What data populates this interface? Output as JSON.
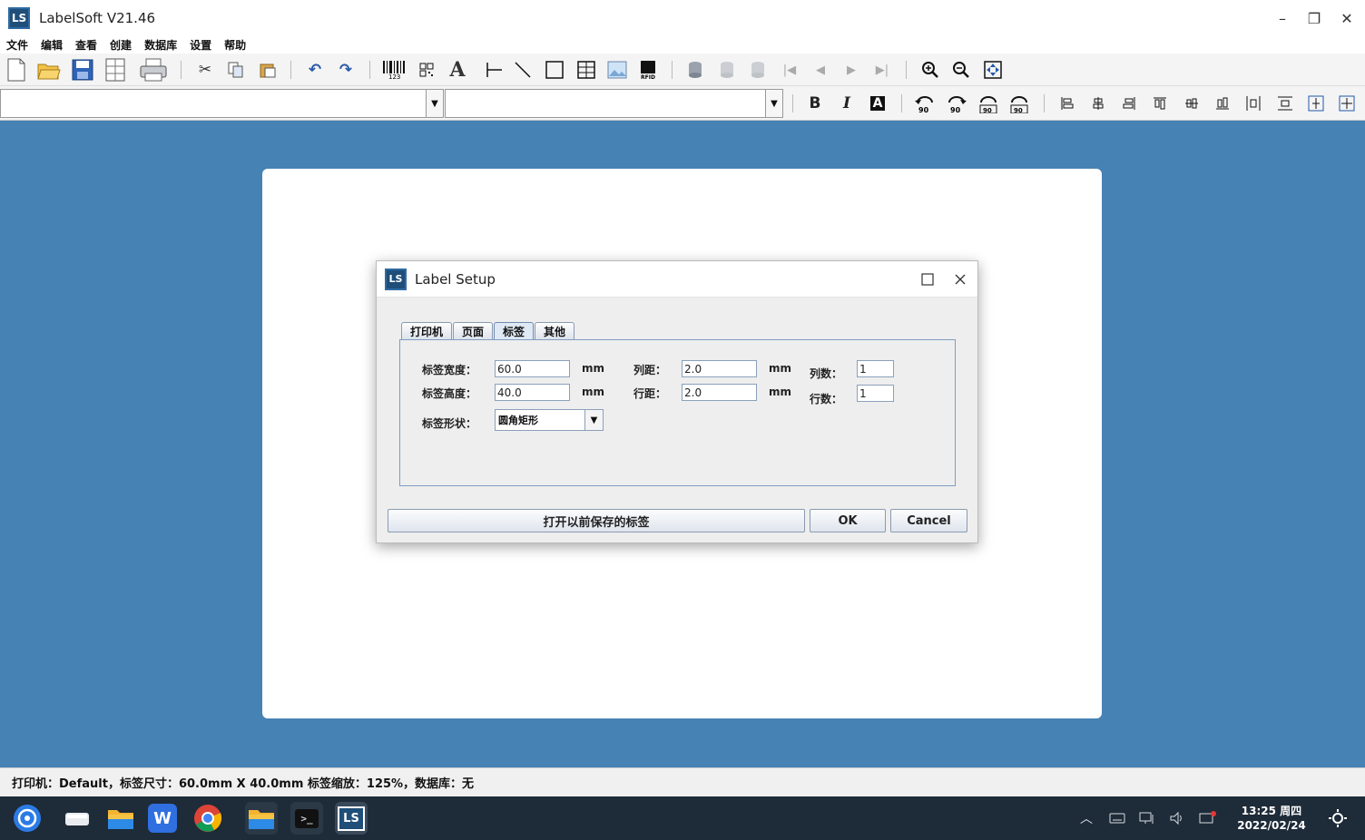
{
  "window": {
    "title": "LabelSoft V21.46",
    "icon_text": "LS",
    "minimize_label": "–",
    "restore_label": "❐",
    "close_label": "✕"
  },
  "menu": [
    "文件",
    "编辑",
    "查看",
    "创建",
    "数据库",
    "设置",
    "帮助"
  ],
  "toolbar2": {
    "font_combo_value": "",
    "size_combo_value": "",
    "bold_label": "B",
    "italic_label": "I",
    "inverse_label": "A"
  },
  "dialog": {
    "title": "Label Setup",
    "icon_text": "LS",
    "tabs": [
      "打印机",
      "页面",
      "标签",
      "其他"
    ],
    "active_tab": "标签",
    "fields": {
      "width_label": "标签宽度：",
      "width_value": "60.0",
      "height_label": "标签高度：",
      "height_value": "40.0",
      "unit": "mm",
      "col_gap_label": "列距：",
      "col_gap_value": "2.0",
      "row_gap_label": "行距：",
      "row_gap_value": "2.0",
      "cols_label": "列数：",
      "cols_value": "1",
      "rows_label": "行数：",
      "rows_value": "1",
      "shape_label": "标签形状：",
      "shape_value": "圆角矩形"
    },
    "open_saved_button": "打开以前保存的标签",
    "ok_button": "OK",
    "cancel_button": "Cancel"
  },
  "status": {
    "text": "打印机：Default，标签尺寸：60.0mm X 40.0mm 标签缩放：125%，数据库：无"
  },
  "taskbar": {
    "clock_time": "13:25 周四",
    "clock_date": "2022/02/24",
    "terminal_glyph": ">_",
    "ls_glyph": "LS",
    "wps_glyph": "W"
  },
  "colors": {
    "workspace": "#4682b4",
    "taskbar": "#1e2b38"
  }
}
